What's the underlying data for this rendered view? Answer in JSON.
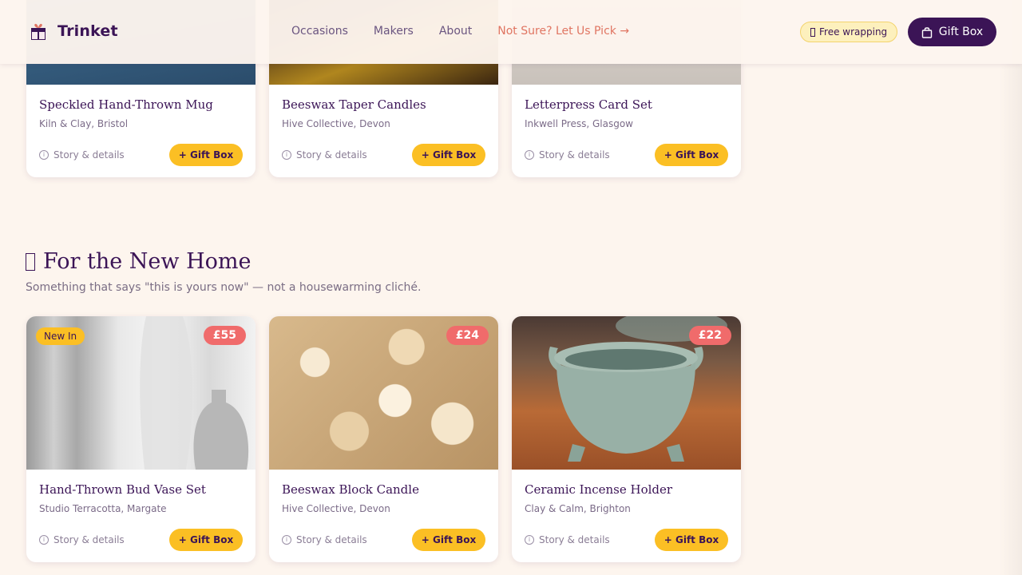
{
  "header": {
    "brand": "Trinket",
    "nav": [
      {
        "label": "Occasions"
      },
      {
        "label": "Makers"
      },
      {
        "label": "About"
      },
      {
        "label": "Not Sure? Let Us Pick →"
      }
    ],
    "wrapping_label": "Free wrapping",
    "giftbox_label": "Gift Box"
  },
  "top_cards": [
    {
      "title": "Speckled Hand-Thrown Mug",
      "maker": "Kiln & Clay, Bristol",
      "story": "Story & details",
      "add": "+ Gift Box"
    },
    {
      "title": "Beeswax Taper Candles",
      "maker": "Hive Collective, Devon",
      "story": "Story & details",
      "add": "+ Gift Box"
    },
    {
      "title": "Letterpress Card Set",
      "maker": "Inkwell Press, Glasgow",
      "story": "Story & details",
      "add": "+ Gift Box"
    }
  ],
  "section": {
    "title": "For the New Home",
    "subtitle": "Something that says \"this is yours now\" — not a housewarming cliché."
  },
  "cards": [
    {
      "badge": "New In",
      "price": "£55",
      "title": "Hand-Thrown Bud Vase Set",
      "maker": "Studio Terracotta, Margate",
      "story": "Story & details",
      "add": "+ Gift Box"
    },
    {
      "price": "£24",
      "title": "Beeswax Block Candle",
      "maker": "Hive Collective, Devon",
      "story": "Story & details",
      "add": "+ Gift Box"
    },
    {
      "price": "£22",
      "title": "Ceramic Incense Holder",
      "maker": "Clay & Calm, Brighton",
      "story": "Story & details",
      "add": "+ Gift Box"
    }
  ],
  "colors": {
    "brand": "#3b1456",
    "accent": "#fbbf24",
    "price": "#f06b6b",
    "highlight_link": "#e07562",
    "background": "#fdf5ee"
  }
}
